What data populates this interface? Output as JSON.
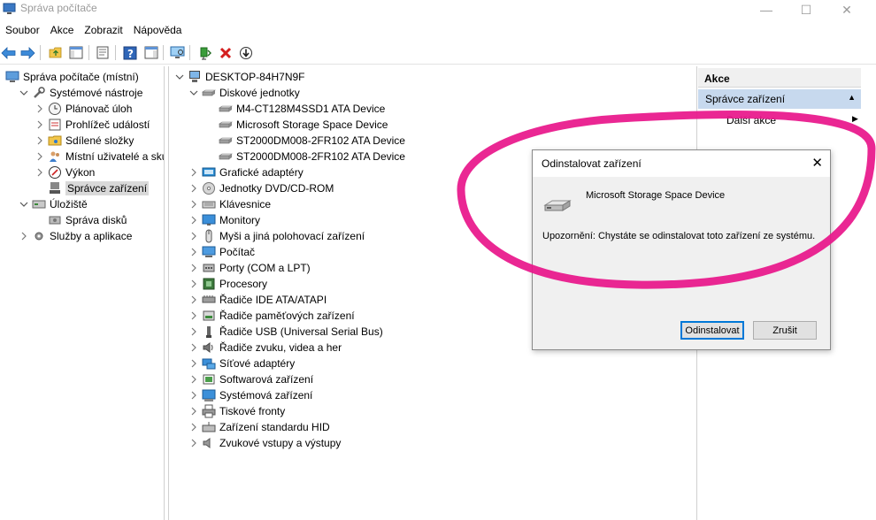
{
  "window": {
    "title": "Správa počítače",
    "controls": {
      "minimize": "—",
      "maximize": "☐",
      "close": "✕"
    }
  },
  "menu": [
    "Soubor",
    "Akce",
    "Zobrazit",
    "Nápověda"
  ],
  "left_tree": [
    {
      "label": "Správa počítače (místní)",
      "icon": "computer-management-icon",
      "expander": ""
    },
    {
      "label": "Systémové nástroje",
      "icon": "tools-icon",
      "expander": "open"
    },
    {
      "label": "Plánovač úloh",
      "icon": "clock-icon",
      "expander": "closed"
    },
    {
      "label": "Prohlížeč událostí",
      "icon": "event-viewer-icon",
      "expander": "closed"
    },
    {
      "label": "Sdílené složky",
      "icon": "shared-folder-icon",
      "expander": "closed"
    },
    {
      "label": "Místní uživatelé a skupiny",
      "icon": "users-icon",
      "expander": "closed"
    },
    {
      "label": "Výkon",
      "icon": "performance-icon",
      "expander": "closed"
    },
    {
      "label": "Správce zařízení",
      "icon": "device-manager-icon",
      "expander": "",
      "selected": true
    },
    {
      "label": "Úložiště",
      "icon": "storage-icon",
      "expander": "open"
    },
    {
      "label": "Správa disků",
      "icon": "disk-management-icon",
      "expander": ""
    },
    {
      "label": "Služby a aplikace",
      "icon": "services-icon",
      "expander": "closed"
    }
  ],
  "device_tree": {
    "root": "DESKTOP-84H7N9F",
    "disk_group": "Diskové jednotky",
    "disks": [
      "M4-CT128M4SSD1 ATA Device",
      "Microsoft Storage Space Device",
      "ST2000DM008-2FR102 ATA Device",
      "ST2000DM008-2FR102 ATA Device"
    ],
    "categories": [
      {
        "label": "Grafické adaptéry",
        "icon": "display-adapter-icon"
      },
      {
        "label": "Jednotky DVD/CD-ROM",
        "icon": "dvd-icon"
      },
      {
        "label": "Klávesnice",
        "icon": "keyboard-icon"
      },
      {
        "label": "Monitory",
        "icon": "monitor-icon"
      },
      {
        "label": "Myši a jiná polohovací zařízení",
        "icon": "mouse-icon"
      },
      {
        "label": "Počítač",
        "icon": "computer-icon"
      },
      {
        "label": "Porty (COM a LPT)",
        "icon": "port-icon"
      },
      {
        "label": "Procesory",
        "icon": "processor-icon"
      },
      {
        "label": "Řadiče IDE ATA/ATAPI",
        "icon": "ide-controller-icon"
      },
      {
        "label": "Řadiče paměťových zařízení",
        "icon": "storage-controller-icon"
      },
      {
        "label": "Řadiče USB (Universal Serial Bus)",
        "icon": "usb-icon"
      },
      {
        "label": "Řadiče zvuku, videa a her",
        "icon": "sound-icon"
      },
      {
        "label": "Síťové adaptéry",
        "icon": "network-adapter-icon"
      },
      {
        "label": "Softwarová zařízení",
        "icon": "software-device-icon"
      },
      {
        "label": "Systémová zařízení",
        "icon": "system-device-icon"
      },
      {
        "label": "Tiskové fronty",
        "icon": "printer-icon"
      },
      {
        "label": "Zařízení standardu HID",
        "icon": "hid-icon"
      },
      {
        "label": "Zvukové vstupy a výstupy",
        "icon": "audio-io-icon"
      }
    ]
  },
  "actions": {
    "header": "Akce",
    "section": "Správce zařízení",
    "more": "Další akce"
  },
  "dialog": {
    "title": "Odinstalovat zařízení",
    "close": "✕",
    "device_name": "Microsoft Storage Space Device",
    "warning": "Upozornění: Chystáte se odinstalovat toto zařízení ze systému.",
    "uninstall_label": "Odinstalovat",
    "cancel_label": "Zrušit"
  },
  "colors": {
    "selection": "#d9d9d9",
    "actions_section": "#c7d9ee",
    "dialog_body": "#f0f0f0",
    "primary_border": "#0078d7",
    "annotation": "#e8158a"
  }
}
